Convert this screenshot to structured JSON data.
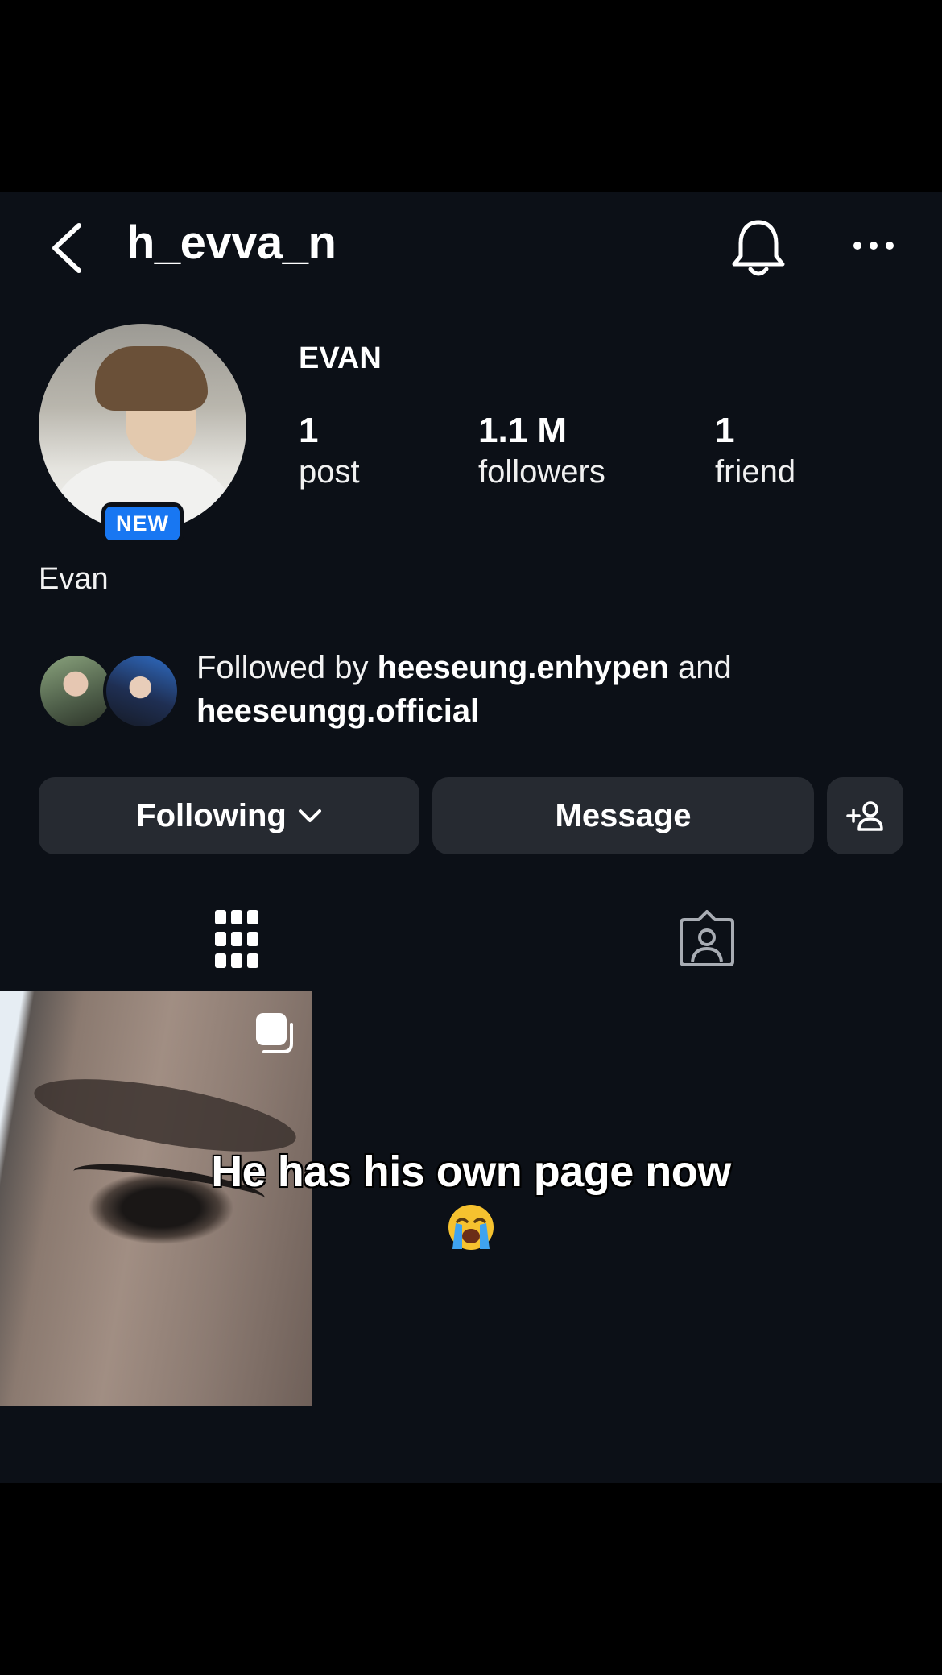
{
  "header": {
    "username": "h_evva_n",
    "icons": [
      "back-chevron-icon",
      "bell-icon",
      "more-icon"
    ]
  },
  "profile": {
    "badge": "NEW",
    "display_name": "EVAN",
    "bio_name": "Evan",
    "stats": [
      {
        "value": "1",
        "label": "post"
      },
      {
        "value": "1.1 M",
        "label": "followers"
      },
      {
        "value": "1",
        "label": "friend"
      }
    ]
  },
  "followed_by": {
    "prefix": "Followed by ",
    "user1": "heeseung.enhypen",
    "joiner": " and",
    "user2": "heeseungg.official"
  },
  "actions": {
    "following_label": "Following",
    "message_label": "Message",
    "add_icon": "add-person-icon"
  },
  "tabs": [
    "grid-icon",
    "tagged-icon"
  ],
  "overlay": {
    "caption": "He has his own page now",
    "emoji": "loudly-crying-face"
  },
  "colors": {
    "background": "#0c1017",
    "button": "#262a31",
    "badge": "#1877f2",
    "text": "#ffffff"
  }
}
